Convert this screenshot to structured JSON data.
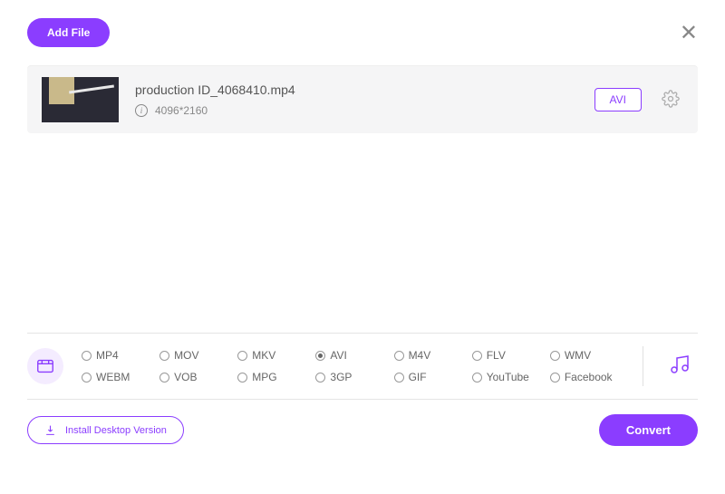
{
  "header": {
    "add_file_label": "Add File"
  },
  "file": {
    "name": "production ID_4068410.mp4",
    "resolution": "4096*2160",
    "target_format": "AVI"
  },
  "formats": {
    "selected": "AVI",
    "row1": [
      "MP4",
      "MOV",
      "MKV",
      "AVI",
      "M4V",
      "FLV",
      "WMV"
    ],
    "row2": [
      "WEBM",
      "VOB",
      "MPG",
      "3GP",
      "GIF",
      "YouTube",
      "Facebook"
    ]
  },
  "footer": {
    "install_label": "Install Desktop Version",
    "convert_label": "Convert"
  }
}
